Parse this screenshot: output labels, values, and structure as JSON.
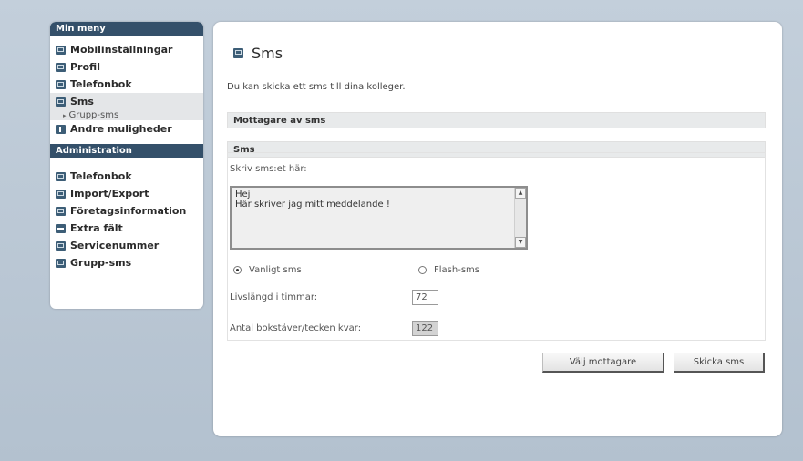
{
  "sidebar": {
    "menu_header": "Min meny",
    "menu_items": [
      {
        "label": "Mobilinställningar",
        "icon": "mobile-settings-icon"
      },
      {
        "label": "Profil",
        "icon": "profile-icon"
      },
      {
        "label": "Telefonbok",
        "icon": "phonebook-icon"
      },
      {
        "label": "Sms",
        "icon": "sms-icon"
      },
      {
        "label": "Andre muligheder",
        "icon": "info-icon"
      }
    ],
    "submenu_item": "Grupp-sms",
    "admin_header": "Administration",
    "admin_items": [
      {
        "label": "Telefonbok",
        "icon": "phonebook-icon"
      },
      {
        "label": "Import/Export",
        "icon": "import-export-icon"
      },
      {
        "label": "Företagsinformation",
        "icon": "company-info-icon"
      },
      {
        "label": "Extra fält",
        "icon": "add-field-icon"
      },
      {
        "label": "Servicenummer",
        "icon": "service-number-icon"
      },
      {
        "label": "Grupp-sms",
        "icon": "group-sms-icon"
      }
    ]
  },
  "main": {
    "title": "Sms",
    "intro": "Du kan skicka ett sms till dina kolleger.",
    "recipients_header": "Mottagare av sms",
    "sms_header": "Sms",
    "write_label": "Skriv sms:et här:",
    "message_line1": "Hej",
    "message_line2": "Här skriver jag mitt meddelande !",
    "radio_regular": "Vanligt sms",
    "radio_flash": "Flash-sms",
    "lifetime_label": "Livslängd i timmar:",
    "lifetime_value": "72",
    "chars_left_label": "Antal bokstäver/tecken kvar:",
    "chars_left_value": "122",
    "choose_recipients_button": "Välj mottagare",
    "send_button": "Skicka sms"
  },
  "colors": {
    "header_bg": "#34506a",
    "page_bg": "#b9c6d3"
  }
}
